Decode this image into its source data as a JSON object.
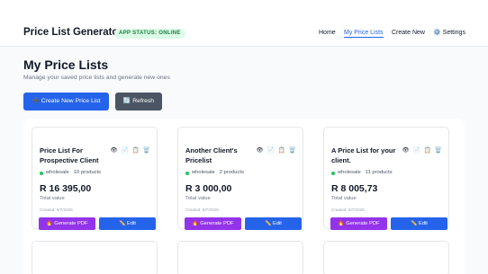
{
  "app": {
    "title": "Price List Generator",
    "status_badge": "APP STATUS: ONLINE"
  },
  "nav": {
    "home": "Home",
    "my_price_lists": "My Price Lists",
    "create_new": "Create New",
    "settings": "⚙️ Settings",
    "active": "my_price_lists"
  },
  "page": {
    "title": "My Price Lists",
    "subtitle": "Manage your saved price lists and generate new ones"
  },
  "actions": {
    "create_label": "➕ Create New Price List",
    "refresh_label": "🔄 Refresh"
  },
  "cards": [
    {
      "title": "Price List For Prospective Client",
      "category": "wholesale",
      "products": "10 products",
      "amount": "R 16 395,00",
      "total_label": "Total value",
      "created": "Created: 9/7/2025",
      "generate_label": "🔥 Generate PDF",
      "edit_label": "✏️ Edit"
    },
    {
      "title": "Another Client's Pricelist",
      "category": "wholesale",
      "products": "2 products",
      "amount": "R 3 000,00",
      "total_label": "Total value",
      "created": "Created: 9/7/2025",
      "generate_label": "🔥 Generate PDF",
      "edit_label": "✏️ Edit"
    },
    {
      "title": "A Price List for your client.",
      "category": "wholesale",
      "products": "11 products",
      "amount": "R 8 005,73",
      "total_label": "Total value",
      "created": "Created: 9/7/2025",
      "generate_label": "🔥 Generate PDF",
      "edit_label": "✏️ Edit"
    }
  ],
  "card_icons": [
    "👁",
    "📄",
    "📋",
    "🗑️"
  ],
  "colors": {
    "accent": "#2563eb",
    "purple": "#9333ea",
    "status_green": "#22c55e",
    "refresh_gray": "#4b5563"
  }
}
